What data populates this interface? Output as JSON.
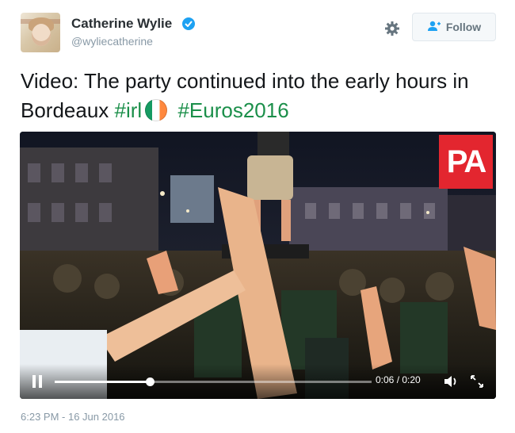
{
  "author": {
    "name": "Catherine Wylie",
    "handle": "@wyliecatherine",
    "verified_icon": "verified-badge-icon",
    "avatar": "profile-photo"
  },
  "actions": {
    "settings_icon": "gear-icon",
    "follow_label": "Follow",
    "follow_icon": "add-user-icon"
  },
  "tweet": {
    "text_part1": "Video: The party continued into the early hours in Bordeaux ",
    "hashtag1": "#irl",
    "flag_icon": "ireland-flag-icon",
    "hashtag2": "#Euros2016",
    "timestamp": "6:23 PM - 16 Jun 2016"
  },
  "video": {
    "logo_text": "PA",
    "logo_color": "#e3262f",
    "time_display": "0:06 / 0:20",
    "progress": 0.3,
    "pause_icon": "pause-icon",
    "volume_icon": "volume-icon",
    "fullscreen_icon": "fullscreen-icon"
  },
  "colors": {
    "hashtag": "#1b8f4a",
    "verified": "#1da1f2",
    "meta_text": "#8899a6"
  }
}
